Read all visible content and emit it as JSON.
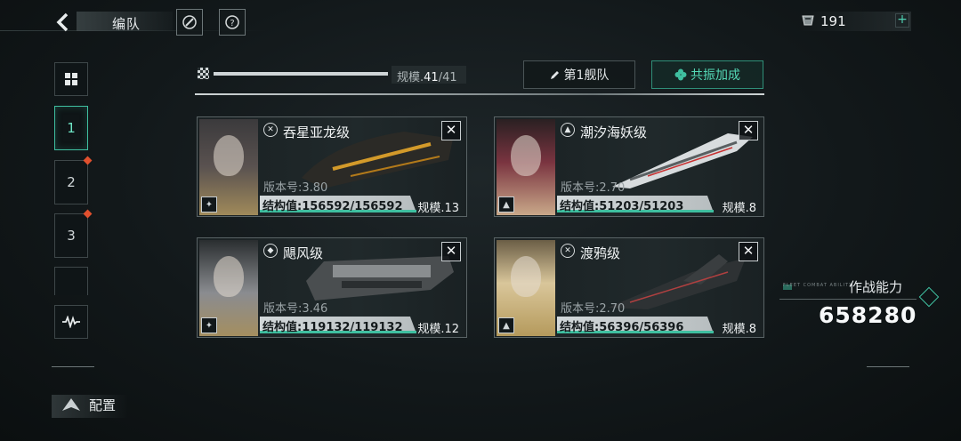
{
  "header": {
    "title": "编队",
    "currency_value": "191"
  },
  "side_tabs": [
    {
      "label": "1",
      "active": true,
      "alert": false
    },
    {
      "label": "2",
      "active": false,
      "alert": true
    },
    {
      "label": "3",
      "active": false,
      "alert": true
    }
  ],
  "scale": {
    "label": "规模.",
    "current": "41",
    "max": "/41",
    "fill": 1.0
  },
  "buttons": {
    "fleet": "第1舰队",
    "resonance": "共振加成"
  },
  "cards": [
    {
      "name": "吞星亚龙级",
      "version": "版本号:3.80",
      "hp": "结构值:156592/156592",
      "hp_fraction": 1.0,
      "scale": "规模.13",
      "portrait": "dark",
      "class_icon": "crosshair-icon"
    },
    {
      "name": "潮汐海妖级",
      "version": "版本号:2.70",
      "hp": "结构值:51203/51203",
      "hp_fraction": 1.0,
      "scale": "规模.8",
      "portrait": "red",
      "class_icon": "wing-icon"
    },
    {
      "name": "飓风级",
      "version": "版本号:3.46",
      "hp": "结构值:119132/119132",
      "hp_fraction": 1.0,
      "scale": "规模.12",
      "portrait": "white",
      "class_icon": "shield-icon"
    },
    {
      "name": "渡鸦级",
      "version": "版本号:2.70",
      "hp": "结构值:56396/56396",
      "hp_fraction": 1.0,
      "scale": "规模.8",
      "portrait": "gold",
      "class_icon": "crosshair-icon"
    }
  ],
  "combat": {
    "label": "作战能力",
    "value": "658280",
    "sub_label": "FLEET COMBAT ABILITY"
  },
  "footer": {
    "config_label": "配置"
  },
  "colors": {
    "accent": "#3fbfa0",
    "alert": "#e0502e"
  }
}
